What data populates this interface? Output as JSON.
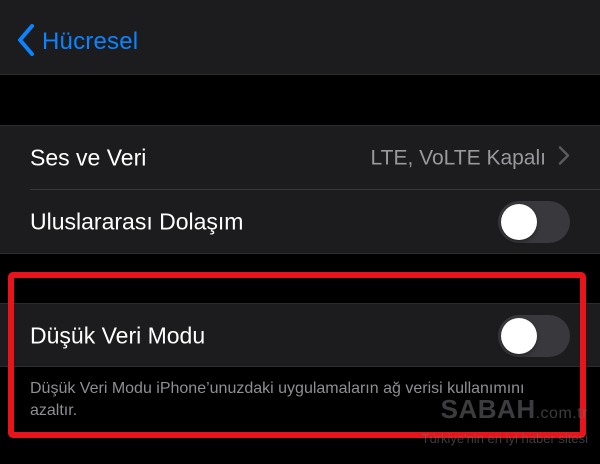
{
  "navbar": {
    "back_label": "Hücresel",
    "back_icon": "chevron-left-icon"
  },
  "settings": {
    "voice_data": {
      "label": "Ses ve Veri",
      "value": "LTE, VoLTE Kapalı"
    },
    "roaming": {
      "label": "Uluslararası Dolaşım",
      "enabled": false
    }
  },
  "low_data": {
    "label": "Düşük Veri Modu",
    "enabled": false,
    "description": "Düşük Veri Modu iPhone’unuzdaki uygulamaların ağ verisi kullanımını azaltır."
  },
  "watermark": {
    "brand": "SABAH",
    "tld": ".com.tr",
    "tagline": "Türkiye'nin en iyi haber sitesi"
  },
  "colors": {
    "accent": "#0a84ff",
    "highlight": "#e8141c",
    "switch_off": "#39393d"
  }
}
